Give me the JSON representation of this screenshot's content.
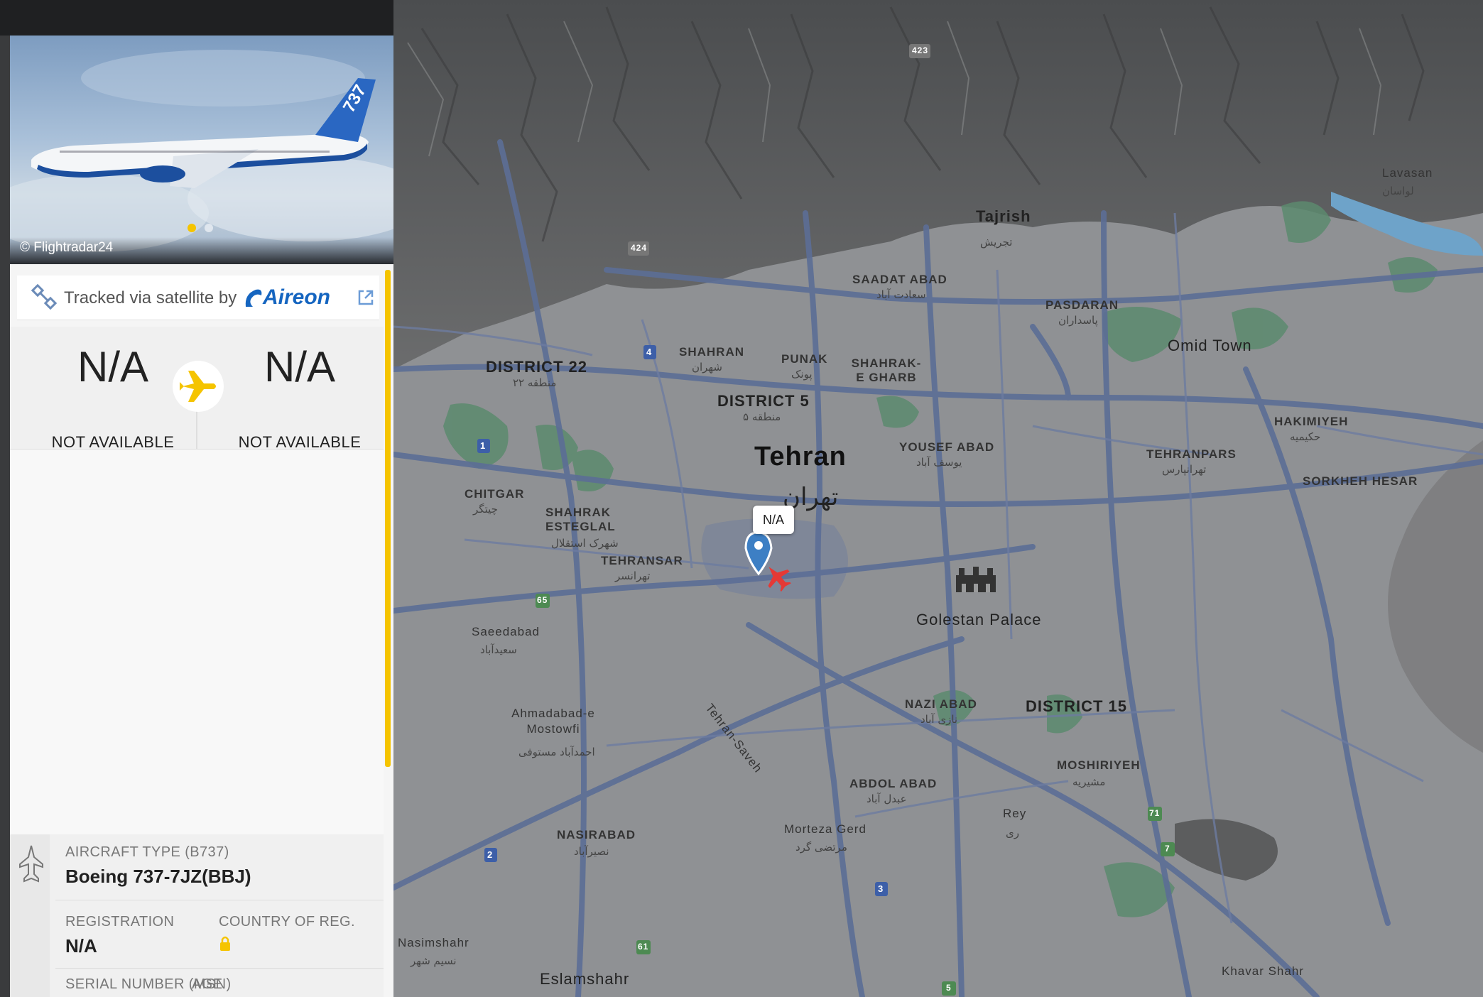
{
  "photo": {
    "credit": "© Flightradar24",
    "tail_text": "737",
    "carousel_dots": 2,
    "active_dot": 0
  },
  "tracking": {
    "label": "Tracked via satellite by",
    "provider": "Aireon"
  },
  "route": {
    "origin_code": "N/A",
    "origin_name": "NOT AVAILABLE",
    "destination_code": "N/A",
    "destination_name": "NOT AVAILABLE"
  },
  "aircraft": {
    "type_label": "AIRCRAFT TYPE (B737)",
    "type_value": "Boeing 737-7JZ(BBJ)",
    "registration_label": "REGISTRATION",
    "registration_value": "N/A",
    "country_label": "COUNTRY OF REG.",
    "serial_label": "SERIAL NUMBER (MSN)",
    "age_label": "AGE"
  },
  "map": {
    "flight_tag": "N/A",
    "labels": {
      "tehran": "Tehran",
      "tehran_fa": "تهران",
      "tajrish": "Tajrish",
      "tajrish_fa": "تجریش",
      "golestan": "Golestan Palace",
      "district22": "DISTRICT 22",
      "district22_fa": "منطقه ۲۲",
      "district5": "DISTRICT 5",
      "district5_fa": "منطقه ۵",
      "district15": "DISTRICT 15",
      "saadat": "SAADAT ABAD",
      "saadat_fa": "سعادت آباد",
      "pasdaran": "PASDARAN",
      "pasdaran_fa": "پاسداران",
      "shahran": "SHAHRAN",
      "shahran_fa": "شهران",
      "punak": "PUNAK",
      "punak_fa": "پونک",
      "shahrak_gharb": "SHAHRAK-E GHARB",
      "omid_town": "Omid Town",
      "hakimiyeh": "HAKIMIYEH",
      "hakimiyeh_fa": "حکیمیه",
      "tehranpars": "TEHRANPARS",
      "tehranpars_fa": "تهرانپارس",
      "yousef_abad": "YOUSEF ABAD",
      "yousef_abad_fa": "یوسف آباد",
      "chitgar": "CHITGAR",
      "chitgar_fa": "چیتگر",
      "shahrak_esteghlal": "SHAHRAK ESTEGLAL",
      "shahrak_esteghlal_fa": "شهرک استقلال",
      "tehransar": "TEHRANSAR",
      "tehransar_fa": "تهرانسر",
      "saeedabad": "Saeedabad",
      "saeedabad_fa": "سعیدآباد",
      "ahmadabad": "Ahmadabad-e Mostowfi",
      "ahmadabad_fa": "احمدآباد مستوفی",
      "nafar_abad": "NAZI ABAD",
      "nafar_abad_fa": "نازی آباد",
      "abdol_abad": "ABDOL ABAD",
      "abdol_abad_fa": "عبدل آباد",
      "moshiriyeh": "MOSHIRIYEH",
      "moshiriyeh_fa": "مشیریه",
      "rey": "Rey",
      "rey_fa": "ری",
      "morteza_gerd": "Morteza Gerd",
      "morteza_gerd_fa": "مرتضی گرد",
      "nasirabad": "NASIRABAD",
      "nasirabad_fa": "نصیرآباد",
      "nasimshahr": "Nasimshahr",
      "nasimshahr_fa": "نسیم شهر",
      "eslamshahr": "Eslamshahr",
      "khavar_shahr": "Khavar Shahr",
      "sorkheh_hesar": "SORKHEH HESAR",
      "lavasan": "Lavasan",
      "lavasan_fa": "لواسان",
      "hwy_423": "423",
      "hwy_424": "424",
      "hwy_4": "4",
      "hwy_1": "1",
      "hwy_2": "2",
      "hwy_7": "7",
      "hwy_5": "5",
      "hwy_3": "3",
      "hwy_61": "61",
      "hwy_65": "65",
      "hwy_71": "71",
      "freeway_label": "Tehran-Saveh"
    }
  },
  "colors": {
    "accent": "#f5c400",
    "aireon_blue": "#1565c0",
    "plane_red": "#e53935",
    "pin_blue": "#3d7fc4"
  }
}
